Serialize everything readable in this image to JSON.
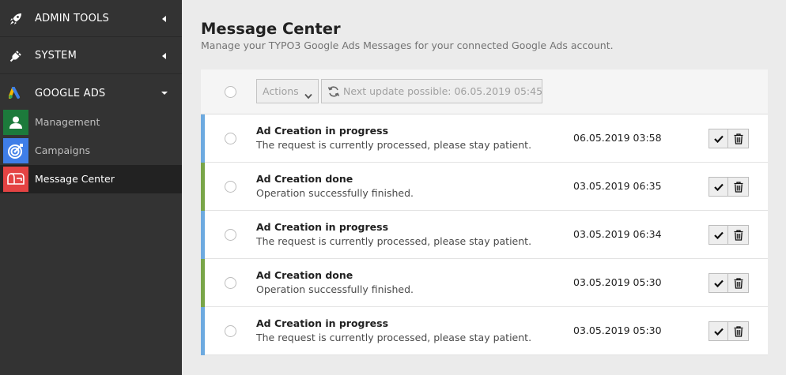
{
  "sidebar": {
    "groups": [
      {
        "label": "ADMIN TOOLS",
        "icon": "rocket-icon",
        "expanded": false
      },
      {
        "label": "SYSTEM",
        "icon": "plug-icon",
        "expanded": false
      },
      {
        "label": "GOOGLE ADS",
        "icon": "google-ads-icon",
        "expanded": true
      }
    ],
    "modules": [
      {
        "label": "Management",
        "icon": "user-icon",
        "color": "#1c7a3b",
        "active": false
      },
      {
        "label": "Campaigns",
        "icon": "target-icon",
        "color": "#3f7ee8",
        "active": false
      },
      {
        "label": "Message Center",
        "icon": "mailbox-icon",
        "color": "#e44343",
        "active": true
      }
    ]
  },
  "main": {
    "title": "Message Center",
    "subtitle": "Manage your TYPO3 Google Ads Messages for your connected Google Ads account.",
    "toolbar": {
      "actions_label": "Actions",
      "update_label": "Next update possible: 06.05.2019 05:45"
    },
    "messages": [
      {
        "title": "Ad Creation in progress",
        "text": "The request is currently processed, please stay patient.",
        "date": "06.05.2019 03:58",
        "status": "info"
      },
      {
        "title": "Ad Creation done",
        "text": "Operation successfully finished.",
        "date": "03.05.2019 06:35",
        "status": "success"
      },
      {
        "title": "Ad Creation in progress",
        "text": "The request is currently processed, please stay patient.",
        "date": "03.05.2019 06:34",
        "status": "info"
      },
      {
        "title": "Ad Creation done",
        "text": "Operation successfully finished.",
        "date": "03.05.2019 05:30",
        "status": "success"
      },
      {
        "title": "Ad Creation in progress",
        "text": "The request is currently processed, please stay patient.",
        "date": "03.05.2019 05:30",
        "status": "info"
      }
    ]
  },
  "colors": {
    "info": "#6daae0",
    "success": "#79a548"
  }
}
